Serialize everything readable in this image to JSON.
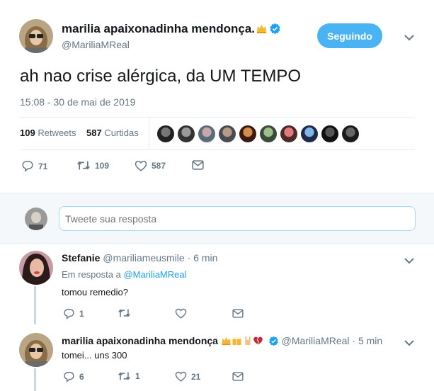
{
  "tweet": {
    "author_name": "marilia apaixonadinha mendonça.",
    "author_handle": "@MariliaMReal",
    "follow_label": "Seguindo",
    "text": "ah nao crise alérgica, da UM TEMPO",
    "timestamp": "15:08 - 30 de mai de 2019",
    "retweets_count": "109",
    "retweets_label": "Retweets",
    "likes_count": "587",
    "likes_label": "Curtidas",
    "reply_count": "71",
    "retweet_count": "109",
    "like_count": "587"
  },
  "reply_box": {
    "placeholder": "Tweete sua resposta"
  },
  "replies": [
    {
      "name": "Stefanie",
      "handle": "@mariliameusmile",
      "time": "· 6 min",
      "in_reply_prefix": "Em resposta a",
      "in_reply_handle": "@MariliaMReal",
      "text": "tomou remedio?",
      "reply_count": "1",
      "retweet_count": "",
      "like_count": ""
    },
    {
      "name": "marilia apaixonadinha mendonça",
      "handle": "@MariliaMReal",
      "time": "· 5 min",
      "text": "tomei... uns 300",
      "reply_count": "6",
      "retweet_count": "1",
      "like_count": "21"
    }
  ],
  "colors": {
    "accent": "#1da1f2",
    "follow_bg": "#4ab3f4",
    "muted": "#657786",
    "border": "#e6ecf0"
  },
  "icons": [
    "crown-icon",
    "verified-icon",
    "chevron-down-icon",
    "reply-icon",
    "retweet-icon",
    "heart-icon",
    "message-icon",
    "beer-icon",
    "rock-hand-icon",
    "broken-heart-icon"
  ]
}
